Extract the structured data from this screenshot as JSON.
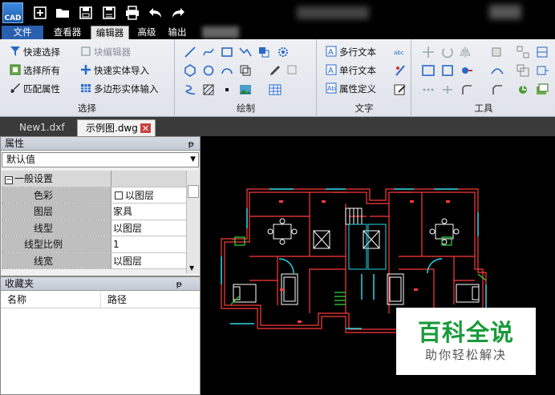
{
  "app": {
    "logo_text": "CAD"
  },
  "menu_tabs": [
    {
      "label": "文件"
    },
    {
      "label": "查看器"
    },
    {
      "label": "编辑器"
    },
    {
      "label": "高级"
    },
    {
      "label": "输出"
    }
  ],
  "ribbon": {
    "select_group": {
      "label": "选择",
      "quick_select": "快速选择",
      "block_editor": "块编辑器",
      "select_all": "选择所有",
      "quick_entity_import": "快速实体导入",
      "match_properties": "匹配属性",
      "polygon_entity_input": "多边形实体输入"
    },
    "draw_group": {
      "label": "绘制"
    },
    "text_group": {
      "label": "文字",
      "mtext": "多行文本",
      "text": "单行文本",
      "attr_def": "属性定义"
    },
    "tools_group": {
      "label": "工具"
    }
  },
  "doc_tabs": [
    {
      "label": "New1.dxf"
    },
    {
      "label": "示例图.dwg"
    }
  ],
  "properties_panel": {
    "title": "属性",
    "pin": "ᵽ",
    "selected": "默认值",
    "group_title": "一般设置",
    "rows": [
      {
        "name": "色彩",
        "value": "以图层"
      },
      {
        "name": "图层",
        "value": "家具"
      },
      {
        "name": "线型",
        "value": "以图层"
      },
      {
        "name": "线型比例",
        "value": "1"
      },
      {
        "name": "线宽",
        "value": "以图层"
      }
    ]
  },
  "favorites_panel": {
    "title": "收藏夹",
    "pin": "ᵽ",
    "col_name": "名称",
    "col_path": "路径"
  },
  "watermark": {
    "title": "百科全说",
    "subtitle": "助你轻松解决"
  },
  "colors": {
    "wall": "#ff3b3b",
    "window": "#29d6e8",
    "furniture": "#ffffff",
    "accent_tab": "#2a5fb0",
    "watermark_green": "#1a9a3a"
  }
}
